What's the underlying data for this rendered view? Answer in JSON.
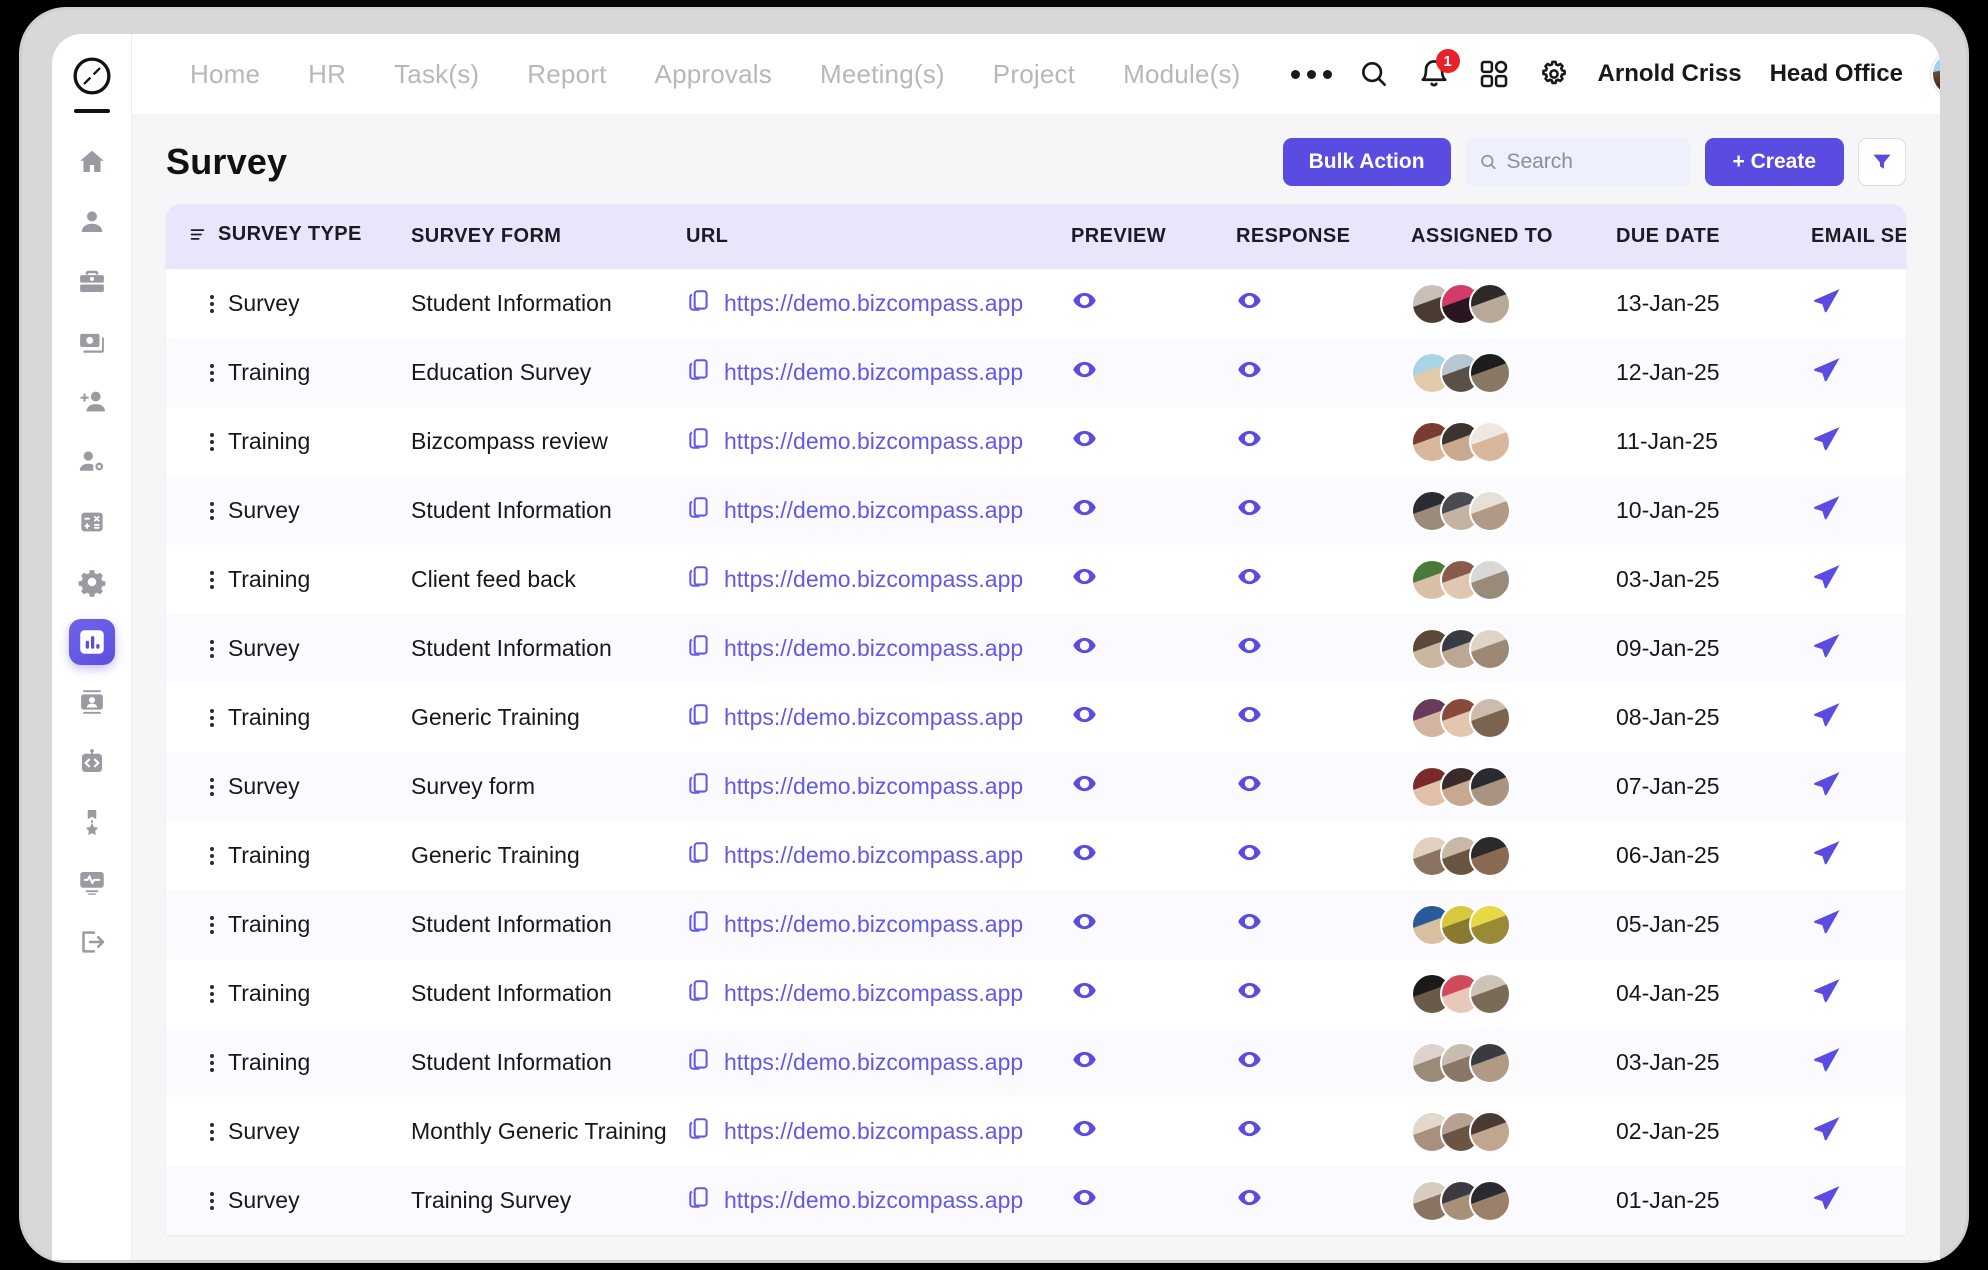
{
  "nav": {
    "items": [
      "Home",
      "HR",
      "Task(s)",
      "Report",
      "Approvals",
      "Meeting(s)",
      "Project",
      "Module(s)"
    ],
    "more_label": "•••"
  },
  "topbar": {
    "notification_count": "1",
    "user_name": "Arnold Criss",
    "office_name": "Head Office"
  },
  "page": {
    "title": "Survey"
  },
  "toolbar": {
    "bulk_action_label": "Bulk Action",
    "create_label": "+ Create",
    "search_placeholder": "Search",
    "search_value": ""
  },
  "colors": {
    "accent": "#5a4ce0",
    "link": "#6259e4",
    "header_bg": "#e9e6fc",
    "row_alt": "#fbfaff",
    "badge": "#e8202a"
  },
  "table": {
    "columns": [
      "SURVEY TYPE",
      "SURVEY FORM",
      "URL",
      "PREVIEW",
      "RESPONSE",
      "ASSIGNED TO",
      "DUE DATE",
      "EMAIL SEND"
    ],
    "rows": [
      {
        "type": "Survey",
        "form": "Student Information",
        "url": "https://demo.bizcompass.app",
        "due": "13-Jan-25",
        "avatars": [
          "#c9bfb6,#4a3b32",
          "#d43a6a,#2a1620",
          "#2e2a2a,#b8a99a"
        ]
      },
      {
        "type": "Training",
        "form": "Education Survey",
        "url": "https://demo.bizcompass.app",
        "due": "12-Jan-25",
        "avatars": [
          "#a9d4e8,#e2c9a8",
          "#b8c6d4,#5a5048",
          "#1d1d1f,#8a7866"
        ]
      },
      {
        "type": "Training",
        "form": "Bizcompass review",
        "url": "https://demo.bizcompass.app",
        "due": "11-Jan-25",
        "avatars": [
          "#7a3b30,#d8b79c",
          "#3c3430,#c9a98e",
          "#efe7e0,#d8b79c"
        ]
      },
      {
        "type": "Survey",
        "form": "Student Information",
        "url": "https://demo.bizcompass.app",
        "due": "10-Jan-25",
        "avatars": [
          "#2b2b33,#9a8a7a",
          "#4a4a52,#c4b2a2",
          "#e8e0d8,#b09a86"
        ]
      },
      {
        "type": "Training",
        "form": "Client feed back",
        "url": "https://demo.bizcompass.app",
        "due": "03-Jan-25",
        "avatars": [
          "#4a7a3a,#d8c0a8",
          "#8a5a4a,#e0c8b0",
          "#d8d8d8,#9a8a7a"
        ]
      },
      {
        "type": "Survey",
        "form": "Student Information",
        "url": "https://demo.bizcompass.app",
        "due": "09-Jan-25",
        "avatars": [
          "#5a4a3a,#cbb6a0",
          "#3a3a42,#bba894",
          "#e0d4c8,#9c8874"
        ]
      },
      {
        "type": "Training",
        "form": "Generic Training",
        "url": "https://demo.bizcompass.app",
        "due": "08-Jan-25",
        "avatars": [
          "#6a3a5a,#d2b4a0",
          "#8a4a3a,#e4c6ae",
          "#cdbcae,#7a6450"
        ]
      },
      {
        "type": "Survey",
        "form": "Survey form",
        "url": "https://demo.bizcompass.app",
        "due": "07-Jan-25",
        "avatars": [
          "#7a2a2a,#e0c0a8",
          "#3a2a2a,#c8a890",
          "#2a2a32,#a89480"
        ]
      },
      {
        "type": "Training",
        "form": "Generic Training",
        "url": "https://demo.bizcompass.app",
        "due": "06-Jan-25",
        "avatars": [
          "#e0d0c0,#8a7460",
          "#c8b8a8,#6a5442",
          "#2a2a2a,#8a6a52"
        ]
      },
      {
        "type": "Training",
        "form": "Student Information",
        "url": "https://demo.bizcompass.app",
        "due": "05-Jan-25",
        "avatars": [
          "#2a5a9a,#d8c0a0",
          "#d8c840,#8a7a30",
          "#e8d848,#9a8a38"
        ]
      },
      {
        "type": "Training",
        "form": "Student Information",
        "url": "https://demo.bizcompass.app",
        "due": "04-Jan-25",
        "avatars": [
          "#1a1a1a,#6a5a4a",
          "#d04a5a,#e8c8b8",
          "#cfc2b6,#7a6a58"
        ]
      },
      {
        "type": "Training",
        "form": "Student Information",
        "url": "https://demo.bizcompass.app",
        "due": "03-Jan-25",
        "avatars": [
          "#dcd4cc,#9a8a78",
          "#c8bcb0,#8a7866",
          "#3a3a42,#b09a84"
        ]
      },
      {
        "type": "Survey",
        "form": "Monthly Generic Training",
        "url": "https://demo.bizcompass.app",
        "due": "02-Jan-25",
        "avatars": [
          "#e4d8cc,#a89080",
          "#b8a092,#6a5444",
          "#4a3a32,#c0a68e"
        ]
      },
      {
        "type": "Survey",
        "form": "Training Survey",
        "url": "https://demo.bizcompass.app",
        "due": "01-Jan-25",
        "avatars": [
          "#d8ccc0,#8a7462",
          "#3a3a40,#a89078",
          "#2a2a30,#9a8068"
        ]
      }
    ]
  },
  "sidebar": {
    "items": [
      {
        "name": "logo-compass",
        "active": false
      },
      {
        "name": "home",
        "active": false
      },
      {
        "name": "person",
        "active": false
      },
      {
        "name": "briefcase",
        "active": false
      },
      {
        "name": "payroll",
        "active": false
      },
      {
        "name": "add-person",
        "active": false
      },
      {
        "name": "person-settings",
        "active": false
      },
      {
        "name": "calculator",
        "active": false
      },
      {
        "name": "gear",
        "active": false
      },
      {
        "name": "chart",
        "active": true
      },
      {
        "name": "contact-card",
        "active": false
      },
      {
        "name": "code-clipboard",
        "active": false
      },
      {
        "name": "award",
        "active": false
      },
      {
        "name": "monitor-pulse",
        "active": false
      },
      {
        "name": "logout",
        "active": false
      }
    ]
  }
}
